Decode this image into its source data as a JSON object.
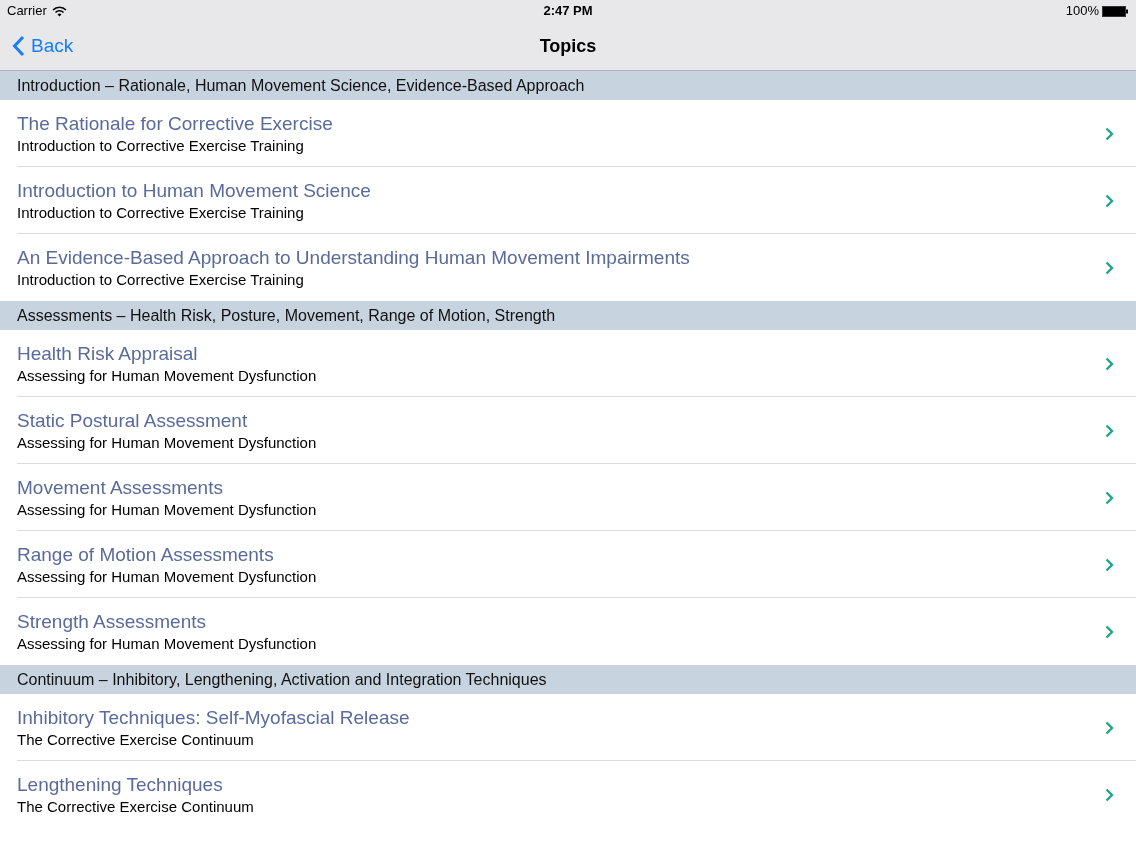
{
  "status_bar": {
    "carrier": "Carrier",
    "time": "2:47 PM",
    "battery": "100%"
  },
  "nav_bar": {
    "back": "Back",
    "title": "Topics"
  },
  "sections": [
    {
      "header": "Introduction – Rationale, Human Movement Science, Evidence-Based Approach",
      "rows": [
        {
          "title": "The Rationale for Corrective Exercise",
          "subtitle": "Introduction to Corrective Exercise Training"
        },
        {
          "title": "Introduction to Human Movement Science",
          "subtitle": "Introduction to Corrective Exercise Training"
        },
        {
          "title": "An Evidence-Based Approach to Understanding Human Movement Impairments",
          "subtitle": "Introduction to Corrective Exercise Training"
        }
      ]
    },
    {
      "header": "Assessments – Health Risk, Posture, Movement, Range of Motion, Strength",
      "rows": [
        {
          "title": "Health Risk Appraisal",
          "subtitle": "Assessing for Human Movement Dysfunction"
        },
        {
          "title": "Static Postural Assessment",
          "subtitle": "Assessing for Human Movement Dysfunction"
        },
        {
          "title": "Movement Assessments",
          "subtitle": "Assessing for Human Movement Dysfunction"
        },
        {
          "title": "Range of Motion Assessments",
          "subtitle": "Assessing for Human Movement Dysfunction"
        },
        {
          "title": "Strength Assessments",
          "subtitle": "Assessing for Human Movement Dysfunction"
        }
      ]
    },
    {
      "header": "Continuum – Inhibitory, Lengthening, Activation and Integration Techniques",
      "rows": [
        {
          "title": "Inhibitory Techniques: Self-Myofascial Release",
          "subtitle": "The Corrective Exercise Continuum"
        },
        {
          "title": "Lengthening Techniques",
          "subtitle": "The Corrective Exercise Continuum"
        }
      ]
    }
  ]
}
